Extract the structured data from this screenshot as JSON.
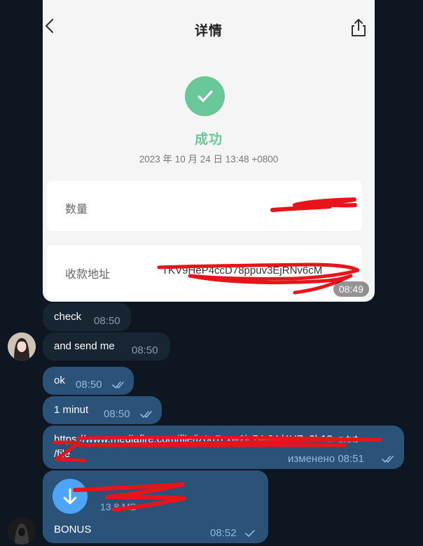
{
  "photo": {
    "title": "详情",
    "status": "成功",
    "date": "2023 年 10 月 24 日 13:48 +0800",
    "amount_label": "数量",
    "address_label": "收款地址",
    "address_value": "TKV9HeP4ccD78ppuv3EjRNv6cM",
    "time": "08:49"
  },
  "messages": [
    {
      "text": "check",
      "time": "08:50",
      "direction": "in"
    },
    {
      "text": "and send me",
      "time": "08:50",
      "direction": "in"
    },
    {
      "text": "ok",
      "time": "08:50",
      "direction": "out",
      "status": "read"
    },
    {
      "text": "1 minut",
      "time": "08:50",
      "direction": "out",
      "status": "read"
    },
    {
      "line1": "https://www.mediafire.com/file/jz0g7cxw2ic74r8A/4UZ_2h12_z.txt",
      "line2": "/file",
      "time": "изменено 08:51",
      "direction": "out",
      "status": "read"
    },
    {
      "file_size": "13.8 MB",
      "caption": "BONUS",
      "time": "08:52",
      "direction": "out",
      "status": "sent"
    }
  ],
  "icons": {
    "back": "chevron-left-icon",
    "share": "share-icon",
    "success": "check-circle-icon",
    "read": "double-check-icon",
    "sent": "single-check-icon",
    "download": "download-arrow-icon"
  },
  "colors": {
    "background": "#0e1621",
    "incoming": "#182533",
    "outgoing": "#2b5278",
    "success": "#6ac79a",
    "download": "#4ea4f6",
    "scribble": "#e8141c"
  }
}
